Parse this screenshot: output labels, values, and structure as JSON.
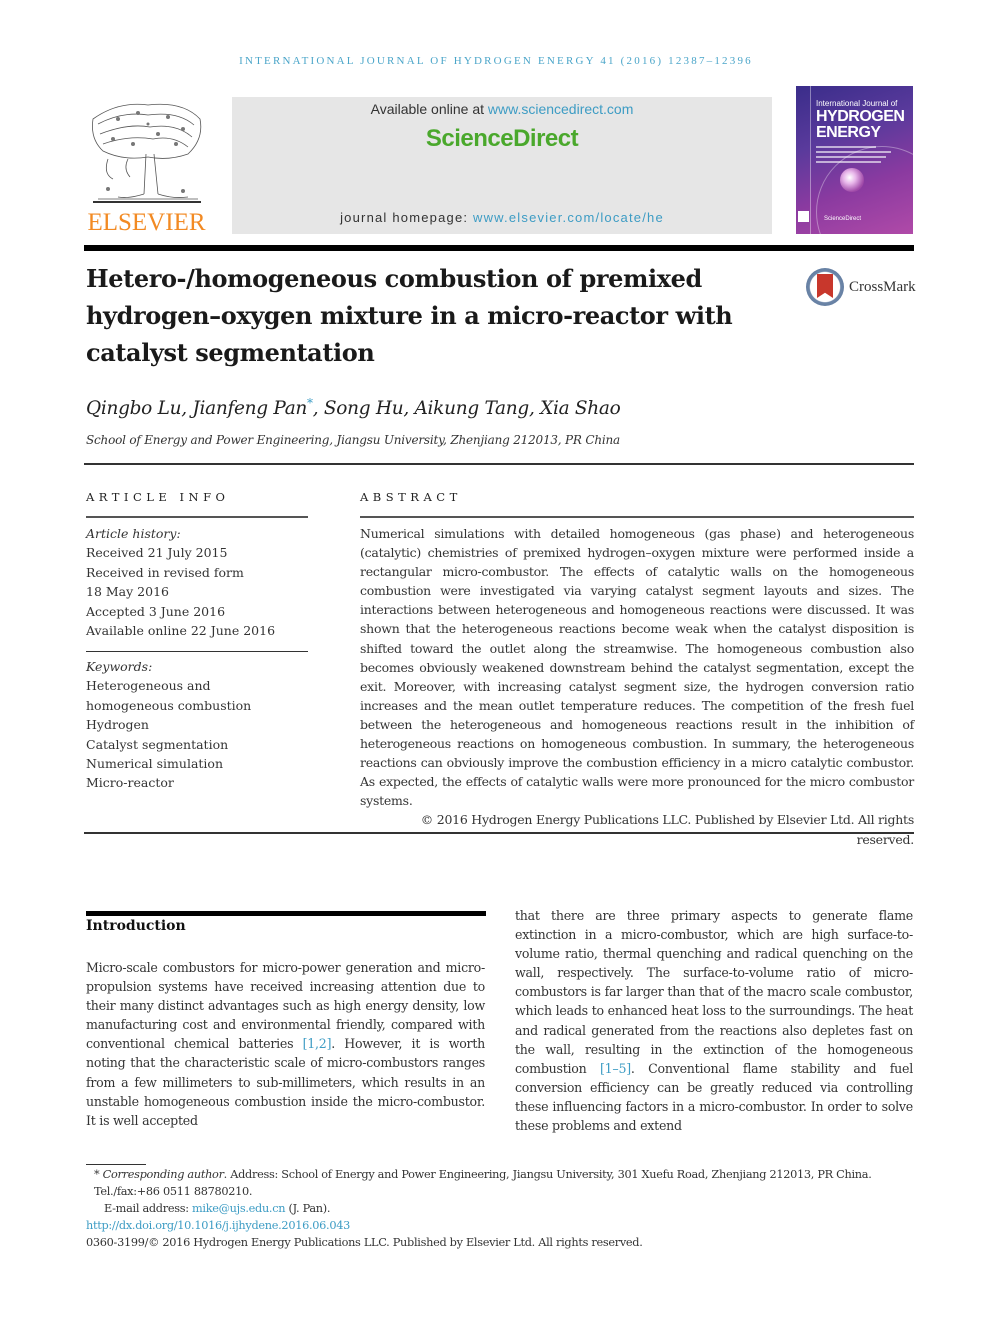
{
  "running_head": "INTERNATIONAL JOURNAL OF HYDROGEN ENERGY 41 (2016) 12387–12396",
  "publisher": {
    "logo_text": "ELSEVIER",
    "brand_color": "#f28a23"
  },
  "banner": {
    "available_prefix": "Available online at ",
    "available_link": "www.sciencedirect.com",
    "sciencedirect_label": "ScienceDirect",
    "sciencedirect_color": "#4aa82c",
    "homepage_prefix": "journal homepage: ",
    "homepage_link": "www.elsevier.com/locate/he",
    "link_color": "#3d9cc4"
  },
  "cover": {
    "line1": "International Journal of",
    "line2": "HYDROGEN",
    "line3": "ENERGY",
    "footer": "ScienceDirect"
  },
  "article": {
    "title": "Hetero-/homogeneous combustion of premixed hydrogen–oxygen mixture in a micro-reactor with catalyst segmentation",
    "crossmark_label": "CrossMark",
    "authors": [
      {
        "name": "Qingbo Lu",
        "sep": ", "
      },
      {
        "name": "Jianfeng Pan",
        "mark": "*",
        "sep": ", "
      },
      {
        "name": "Song Hu",
        "sep": ", "
      },
      {
        "name": "Aikung Tang",
        "sep": ", "
      },
      {
        "name": "Xia Shao",
        "sep": ""
      }
    ],
    "affiliation": "School of Energy and Power Engineering, Jiangsu University, Zhenjiang 212013, PR China"
  },
  "article_info": {
    "heading": "ARTICLE INFO",
    "history_label": "Article history:",
    "history": [
      "Received 21 July 2015",
      "Received in revised form",
      "18 May 2016",
      "Accepted 3 June 2016",
      "Available online 22 June 2016"
    ],
    "keywords_label": "Keywords:",
    "keywords": [
      "Heterogeneous and homogeneous combustion",
      "Hydrogen",
      "Catalyst segmentation",
      "Numerical simulation",
      "Micro-reactor"
    ]
  },
  "abstract": {
    "heading": "ABSTRACT",
    "text": "Numerical simulations with detailed homogeneous (gas phase) and heterogeneous (catalytic) chemistries of premixed hydrogen–oxygen mixture were performed inside a rectangular micro-combustor. The effects of catalytic walls on the homogeneous combustion were investigated via varying catalyst segment layouts and sizes. The interactions between heterogeneous and homogeneous reactions were discussed. It was shown that the heterogeneous reactions become weak when the catalyst disposition is shifted toward the outlet along the streamwise. The homogeneous combustion also becomes obviously weakened downstream behind the catalyst segmentation, except the exit. Moreover, with increasing catalyst segment size, the hydrogen conversion ratio increases and the mean outlet temperature reduces. The competition of the fresh fuel between the heterogeneous and homogeneous reactions result in the inhibition of heterogeneous reactions on homogeneous combustion. In summary, the heterogeneous reactions can obviously improve the combustion efficiency in a micro catalytic combustor. As expected, the effects of catalytic walls were more pronounced for the micro combustor systems.",
    "copyright": "© 2016 Hydrogen Energy Publications LLC. Published by Elsevier Ltd. All rights reserved."
  },
  "introduction": {
    "heading": "Introduction",
    "left_p1_a": "Micro-scale combustors for micro-power generation and micro-propulsion systems have received increasing attention due to their many distinct advantages such as high energy density, low manufacturing cost and environmental friendly, compared with conventional chemical batteries ",
    "left_ref1": "[1,2]",
    "left_p1_b": ". However, it is worth noting that the characteristic scale of micro-combustors ranges from a few millimeters to sub-millimeters, which results in an unstable homogeneous combustion inside the micro-combustor. It is well accepted",
    "right_a": "that there are three primary aspects to generate flame extinction in a micro-combustor, which are high surface-to-volume ratio, thermal quenching and radical quenching on the wall, respectively. The surface-to-volume ratio of micro-combustors is far larger than that of the macro scale combustor, which leads to enhanced heat loss to the surroundings. The heat and radical generated from the reactions also depletes fast on the wall, resulting in the extinction of the homogeneous combustion ",
    "right_ref": "[1–5]",
    "right_b": ". Conventional flame stability and fuel conversion efficiency can be greatly reduced via controlling these influencing factors in a micro-combustor. In order to solve these problems and extend"
  },
  "footnotes": {
    "star": "*",
    "corresponding_label": "Corresponding author",
    "corresponding_text": ". Address: School of Energy and Power Engineering, Jiangsu University, 301 Xuefu Road, Zhenjiang 212013, PR China. Tel./fax:+86 0511 88780210.",
    "email_label": "E-mail address: ",
    "email": "mike@ujs.edu.cn",
    "email_suffix": " (J. Pan).",
    "doi": "http://dx.doi.org/10.1016/j.ijhydene.2016.06.043",
    "issn_line": "0360-3199/© 2016 Hydrogen Energy Publications LLC. Published by Elsevier Ltd. All rights reserved."
  }
}
